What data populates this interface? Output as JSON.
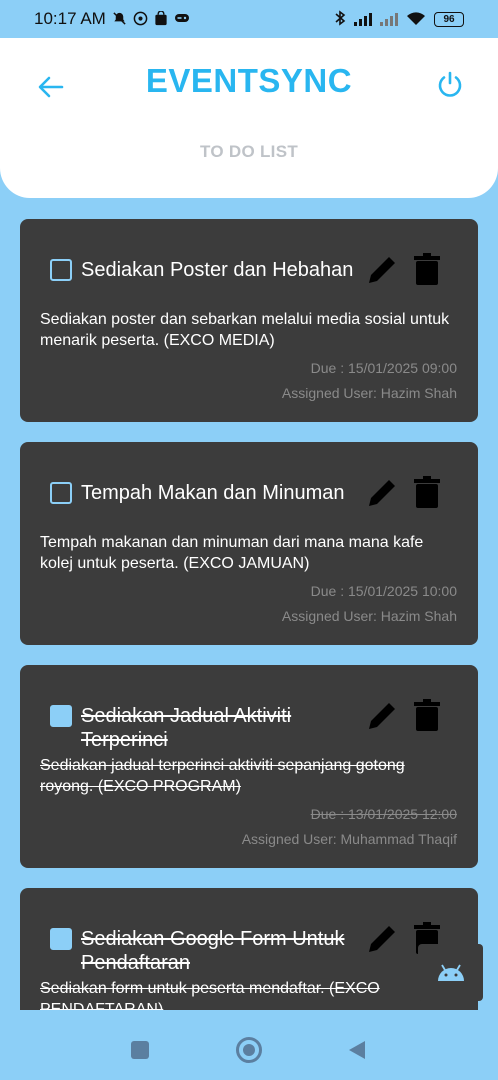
{
  "status_bar": {
    "time": "10:17 AM",
    "battery": "96"
  },
  "header": {
    "app_title": "EVENTSYNC",
    "subtitle": "TO DO LIST",
    "accent_color": "#29b6f0"
  },
  "tasks": [
    {
      "title": "Sediakan Poster dan Hebahan",
      "description": "Sediakan poster dan sebarkan melalui media sosial untuk menarik peserta. (EXCO MEDIA)",
      "due": "Due : 15/01/2025 09:00",
      "assigned": "Assigned User: Hazim Shah",
      "completed": false
    },
    {
      "title": "Tempah Makan dan Minuman",
      "description": "Tempah makanan dan minuman dari mana mana kafe kolej untuk peserta. (EXCO JAMUAN)",
      "due": "Due : 15/01/2025 10:00",
      "assigned": "Assigned User: Hazim Shah",
      "completed": false
    },
    {
      "title": "Sediakan Jadual Aktiviti Terperinci",
      "description": "Sediakan jadual terperinci aktiviti sepanjang gotong royong. (EXCO PROGRAM)",
      "due": "Due : 13/01/2025 12:00",
      "assigned": "Assigned User: Muhammad Thaqif",
      "completed": true
    },
    {
      "title": "Sediakan Google Form Untuk Pendaftaran",
      "description": "Sediakan form untuk peserta mendaftar. (EXCO PENDAFTARAN)",
      "due": "",
      "assigned": "",
      "completed": true
    }
  ],
  "icons": {
    "back": "arrow-left-icon",
    "power": "power-icon",
    "edit": "pencil-icon",
    "delete": "trash-icon",
    "fab": "android-icon"
  }
}
